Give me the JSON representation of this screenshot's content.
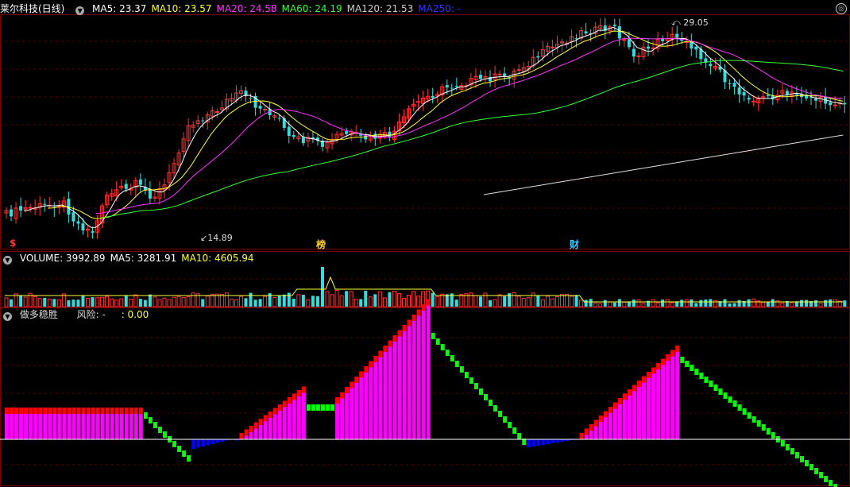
{
  "main_header": {
    "title": "莱尔科技(日线)",
    "indicators": [
      {
        "label": "MA5: 23.37",
        "color": "#ffffff"
      },
      {
        "label": "MA10: 23.57",
        "color": "#ffff33"
      },
      {
        "label": "MA20: 24.58",
        "color": "#ff33ff"
      },
      {
        "label": "MA60: 24.19",
        "color": "#33ff33"
      },
      {
        "label": "MA120: 21.53",
        "color": "#cccccc"
      },
      {
        "label": "MA250: -",
        "color": "#3333ff"
      }
    ]
  },
  "annotations": {
    "high": "29.05",
    "low": "14.89"
  },
  "markers": [
    {
      "text": "$",
      "color": "#ff3333"
    },
    {
      "text": "榜",
      "color": "#ffcc33"
    },
    {
      "text": "财",
      "color": "#33ccff"
    }
  ],
  "volume_header": {
    "indicators": [
      {
        "label": "VOLUME: 3992.89",
        "color": "#ffffff"
      },
      {
        "label": "MA5: 3281.91",
        "color": "#ffffff"
      },
      {
        "label": "MA10: 4605.94",
        "color": "#ffff33"
      }
    ]
  },
  "indicator_header": {
    "name": "做多稳胜",
    "risk_label": "风险: -",
    "value": ": 0.00"
  },
  "colors": {
    "up": "#ff3333",
    "down": "#33dddd",
    "grid": "#550000",
    "pink": "#ff00ff",
    "red": "#ff0000",
    "green": "#00ff00",
    "blue": "#0000ff",
    "yellow": "#ffff00"
  },
  "chart_data": {
    "type": "candlestick",
    "price_high": 29.05,
    "price_low": 14.89
  }
}
